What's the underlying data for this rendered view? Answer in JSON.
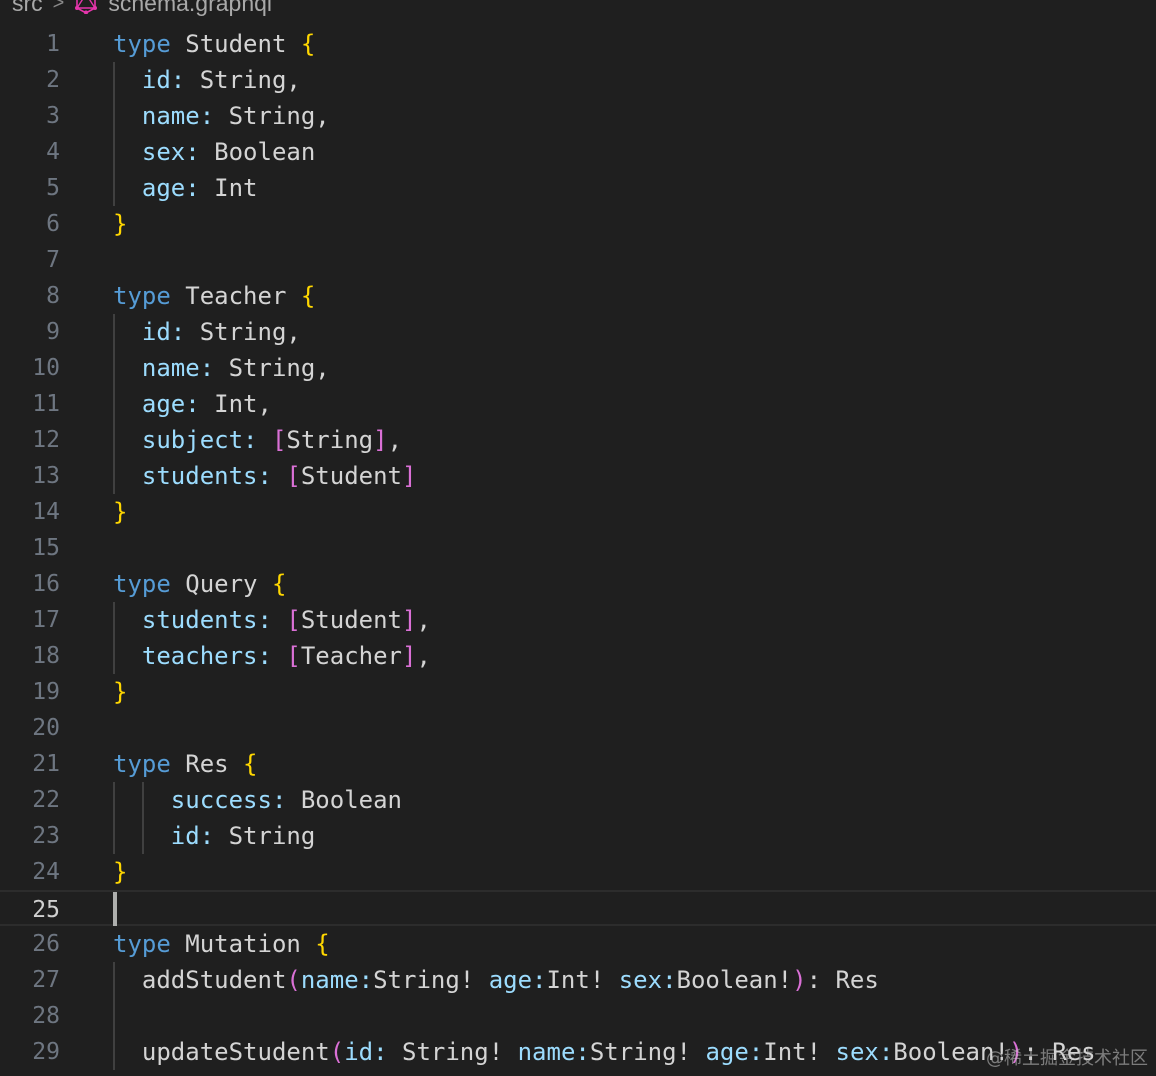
{
  "breadcrumb": {
    "folder": "src",
    "separator": ">",
    "file": "schema.graphql",
    "file_icon": "graphql-icon"
  },
  "editor": {
    "current_line": 25,
    "lines": [
      [
        [
          "k",
          "type"
        ],
        [
          "t",
          " Student "
        ],
        [
          "b",
          "{"
        ]
      ],
      [
        [
          "f",
          "  id:"
        ],
        [
          "t",
          " String,"
        ]
      ],
      [
        [
          "f",
          "  name:"
        ],
        [
          "t",
          " String,"
        ]
      ],
      [
        [
          "f",
          "  sex:"
        ],
        [
          "t",
          " Boolean"
        ]
      ],
      [
        [
          "f",
          "  age:"
        ],
        [
          "t",
          " Int"
        ]
      ],
      [
        [
          "b",
          "}"
        ]
      ],
      [],
      [
        [
          "k",
          "type"
        ],
        [
          "t",
          " Teacher "
        ],
        [
          "b",
          "{"
        ]
      ],
      [
        [
          "f",
          "  id:"
        ],
        [
          "t",
          " String,"
        ]
      ],
      [
        [
          "f",
          "  name:"
        ],
        [
          "t",
          " String,"
        ]
      ],
      [
        [
          "f",
          "  age:"
        ],
        [
          "t",
          " Int,"
        ]
      ],
      [
        [
          "f",
          "  subject:"
        ],
        [
          "t",
          " "
        ],
        [
          "s",
          "["
        ],
        [
          "t",
          "String"
        ],
        [
          "s",
          "]"
        ],
        [
          "p",
          ","
        ]
      ],
      [
        [
          "f",
          "  students:"
        ],
        [
          "t",
          " "
        ],
        [
          "s",
          "["
        ],
        [
          "t",
          "Student"
        ],
        [
          "s",
          "]"
        ]
      ],
      [
        [
          "b",
          "}"
        ]
      ],
      [],
      [
        [
          "k",
          "type"
        ],
        [
          "t",
          " Query "
        ],
        [
          "b",
          "{"
        ]
      ],
      [
        [
          "f",
          "  students:"
        ],
        [
          "t",
          " "
        ],
        [
          "s",
          "["
        ],
        [
          "t",
          "Student"
        ],
        [
          "s",
          "]"
        ],
        [
          "p",
          ","
        ]
      ],
      [
        [
          "f",
          "  teachers:"
        ],
        [
          "t",
          " "
        ],
        [
          "s",
          "["
        ],
        [
          "t",
          "Teacher"
        ],
        [
          "s",
          "]"
        ],
        [
          "p",
          ","
        ]
      ],
      [
        [
          "b",
          "}"
        ]
      ],
      [],
      [
        [
          "k",
          "type"
        ],
        [
          "t",
          " Res "
        ],
        [
          "b",
          "{"
        ]
      ],
      [
        [
          "f",
          "    success:"
        ],
        [
          "t",
          " Boolean"
        ]
      ],
      [
        [
          "f",
          "    id:"
        ],
        [
          "t",
          " String"
        ]
      ],
      [
        [
          "b",
          "}"
        ]
      ],
      [],
      [
        [
          "k",
          "type"
        ],
        [
          "t",
          " Mutation "
        ],
        [
          "b",
          "{"
        ]
      ],
      [
        [
          "t",
          "  addStudent"
        ],
        [
          "s",
          "("
        ],
        [
          "f",
          "name:"
        ],
        [
          "t",
          "String! "
        ],
        [
          "f",
          "age:"
        ],
        [
          "t",
          "Int! "
        ],
        [
          "f",
          "sex:"
        ],
        [
          "t",
          "Boolean!"
        ],
        [
          "s",
          ")"
        ],
        [
          "p",
          ": Res"
        ]
      ],
      [
        [
          "t",
          "  "
        ]
      ],
      [
        [
          "t",
          "  updateStudent"
        ],
        [
          "s",
          "("
        ],
        [
          "f",
          "id:"
        ],
        [
          "t",
          " String! "
        ],
        [
          "f",
          "name:"
        ],
        [
          "t",
          "String! "
        ],
        [
          "f",
          "age:"
        ],
        [
          "t",
          "Int! "
        ],
        [
          "f",
          "sex:"
        ],
        [
          "t",
          "Boolean!"
        ],
        [
          "s",
          ")"
        ],
        [
          "p",
          ": Res"
        ]
      ]
    ]
  },
  "watermark": "@稀土掘金技术社区"
}
